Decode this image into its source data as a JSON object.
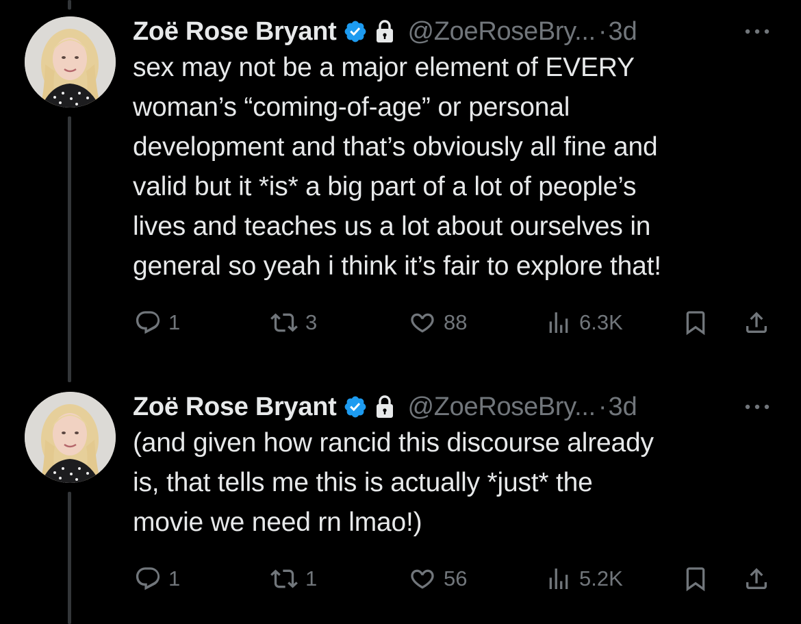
{
  "tweets": [
    {
      "display_name": "Zoë Rose Bryant",
      "handle": "@ZoeRoseBry...",
      "dot": "·",
      "time": "3d",
      "text": "sex may not be a major element of EVERY\nwoman’s “coming-of-age” or personal\ndevelopment and that’s obviously all fine and\nvalid but it *is* a big part of a lot of people’s\nlives and teaches us a lot about ourselves in\ngeneral so yeah i think it’s fair to explore that!",
      "replies": "1",
      "reposts": "3",
      "likes": "88",
      "views": "6.3K",
      "icons": [
        "verified-badge-icon",
        "lock-icon",
        "more-icon",
        "reply-icon",
        "repost-icon",
        "like-icon",
        "views-icon",
        "bookmark-icon",
        "share-icon"
      ]
    },
    {
      "display_name": "Zoë Rose Bryant",
      "handle": "@ZoeRoseBry...",
      "dot": "·",
      "time": "3d",
      "text": "(and given how rancid this discourse already\nis, that tells me this is actually *just* the\nmovie we need rn lmao!)",
      "replies": "1",
      "reposts": "1",
      "likes": "56",
      "views": "5.2K",
      "icons": [
        "verified-badge-icon",
        "lock-icon",
        "more-icon",
        "reply-icon",
        "repost-icon",
        "like-icon",
        "views-icon",
        "bookmark-icon",
        "share-icon"
      ]
    }
  ],
  "colors": {
    "background": "#000000",
    "primary_text": "#e7e9ea",
    "secondary_text": "#71767b",
    "verified_blue": "#1d9bf0",
    "thread_line": "#333639"
  }
}
